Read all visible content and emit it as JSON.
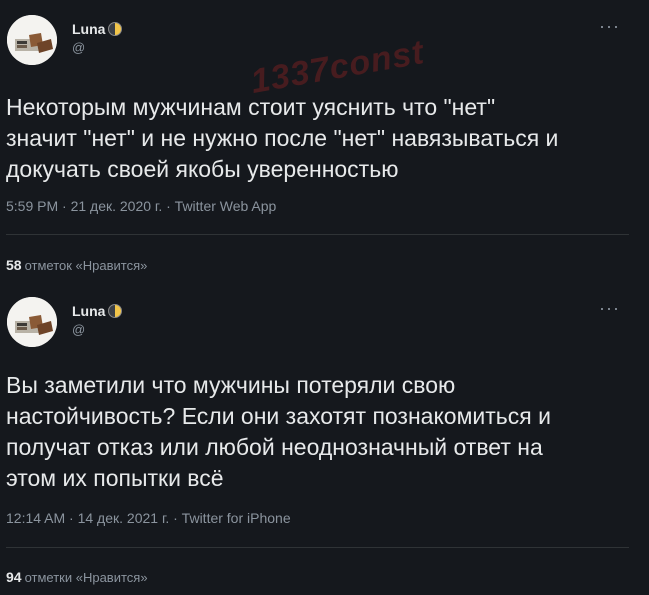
{
  "watermark": "1337const",
  "tweets": [
    {
      "display_name": "Luna",
      "handle": "@",
      "more": "···",
      "text_lines": [
        "Некоторым мужчинам стоит уяснить что \"нет\"",
        "значит \"нет\" и не нужно после \"нет\" навязываться и",
        "докучать своей якобы уверенностью"
      ],
      "meta": "5:59 PM · 21 дек. 2020 г. · Twitter Web App",
      "likes_count": "58",
      "likes_label": "отметок «Нравится»"
    },
    {
      "display_name": "Luna",
      "handle": "@",
      "more": "···",
      "text_lines": [
        "Вы заметили что мужчины потеряли свою",
        "настойчивость? Если они захотят познакомиться и",
        "получат отказ или любой неоднозначный ответ на",
        "этом их попытки всё"
      ],
      "meta": "12:14 AM · 14 дек. 2021 г. · Twitter for iPhone",
      "likes_count": "94",
      "likes_label": "отметки «Нравится»"
    }
  ]
}
